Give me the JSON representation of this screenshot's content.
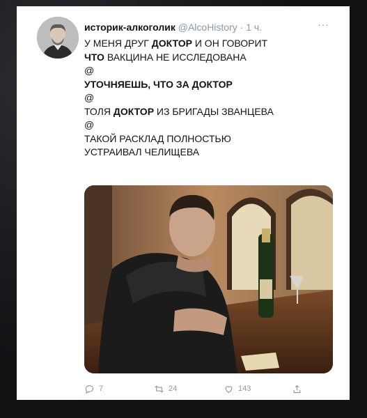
{
  "tweet": {
    "author_name": "историк-алкоголик",
    "handle": "@AlcoHistory",
    "separator": " · ",
    "time": "1 ч.",
    "more_icon": "more-dots-icon",
    "lines": [
      {
        "parts": [
          {
            "text": "У МЕНЯ ДРУГ ",
            "bold": false
          },
          {
            "text": "ДОКТОР",
            "bold": true
          },
          {
            "text": " И ОН ГОВОРИТ",
            "bold": false
          }
        ]
      },
      {
        "parts": [
          {
            "text": "ЧТО",
            "bold": true
          },
          {
            "text": " ВАКЦИНА НЕ ИССЛЕДОВАНА",
            "bold": false
          }
        ]
      },
      {
        "parts": [
          {
            "text": "@",
            "bold": false
          }
        ]
      },
      {
        "parts": [
          {
            "text": "УТОЧНЯЕШЬ, ЧТО ЗА ДОКТОР",
            "bold": true
          }
        ]
      },
      {
        "parts": [
          {
            "text": "@",
            "bold": false
          }
        ]
      },
      {
        "parts": [
          {
            "text": "ТОЛЯ ",
            "bold": false
          },
          {
            "text": "ДОКТОР",
            "bold": true
          },
          {
            "text": " ИЗ БРИГАДЫ ЗВАНЦЕВА",
            "bold": false
          }
        ]
      },
      {
        "parts": [
          {
            "text": "@",
            "bold": false
          }
        ]
      },
      {
        "parts": [
          {
            "text": "ТАКОЙ РАСКЛАД ПОЛНОСТЬЮ",
            "bold": false
          }
        ]
      },
      {
        "parts": [
          {
            "text": "УСТРАИВАЛ ЧЕЛИЩЕВА",
            "bold": false
          }
        ]
      }
    ]
  },
  "actions": {
    "reply": {
      "icon": "reply-icon",
      "count": "7"
    },
    "retweet": {
      "icon": "retweet-icon",
      "count": "24"
    },
    "like": {
      "icon": "heart-icon",
      "count": "143"
    },
    "share": {
      "icon": "share-icon"
    }
  },
  "colors": {
    "text": "#0f1419",
    "muted": "#8b98a5",
    "background_outer": "#111114",
    "card": "#ffffff"
  }
}
